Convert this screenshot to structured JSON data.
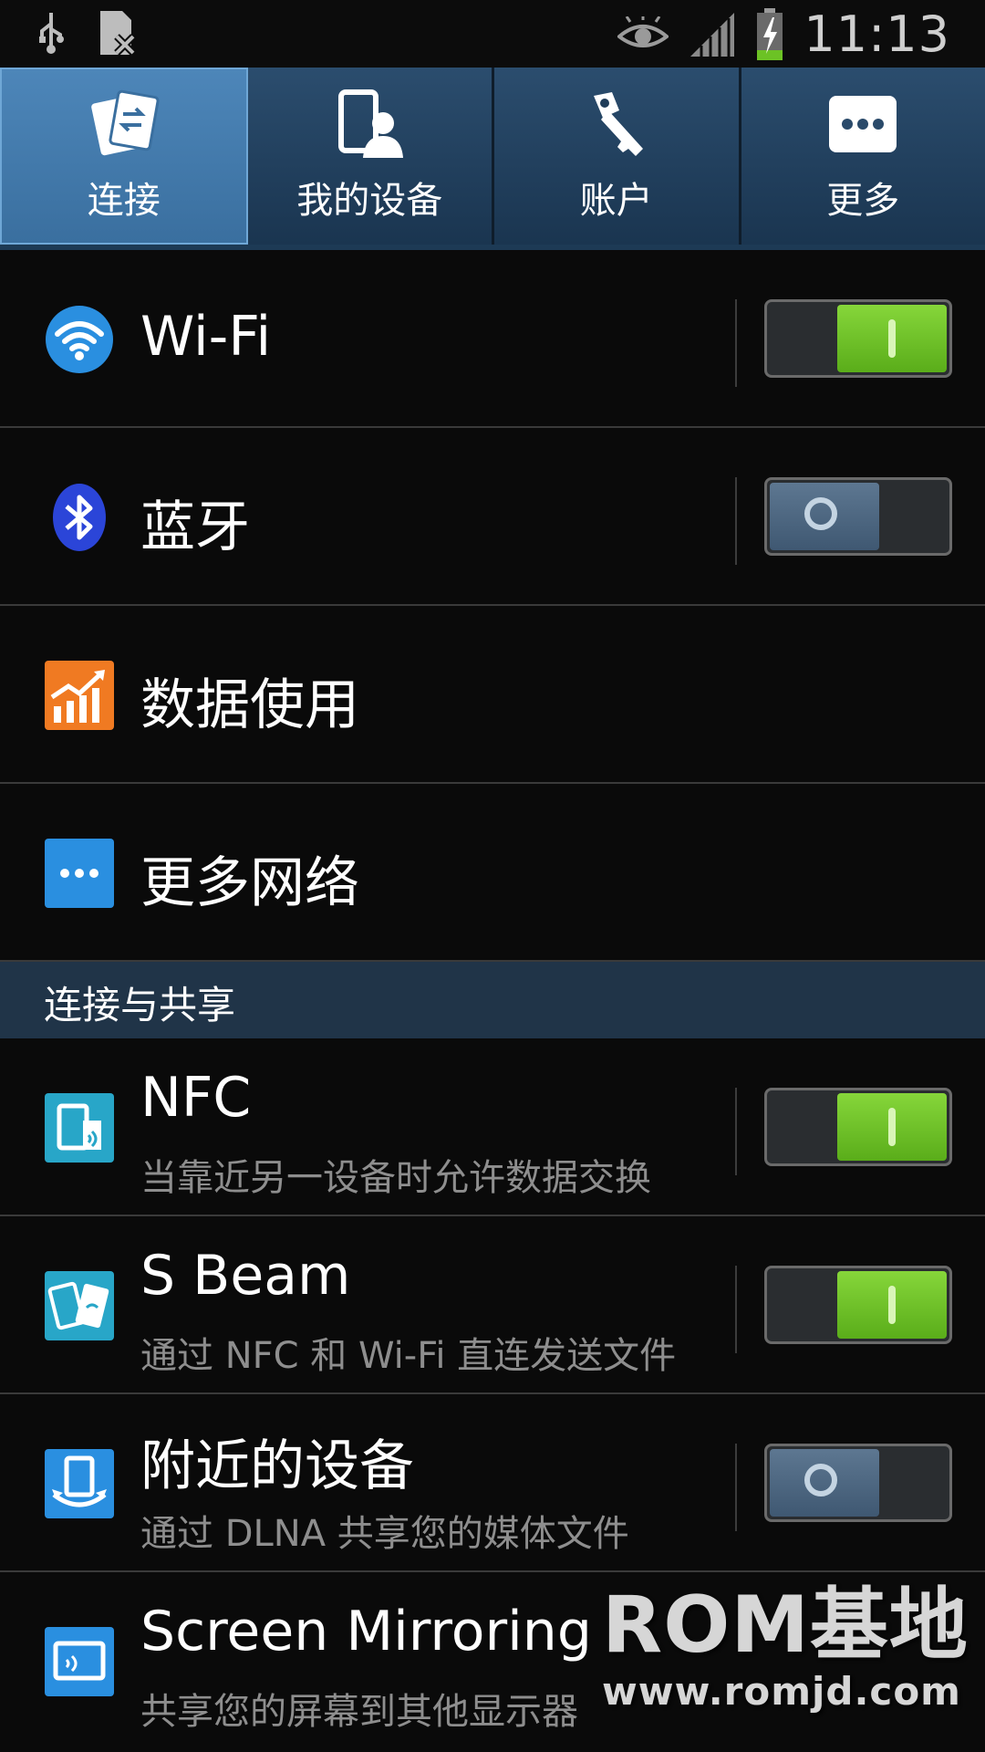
{
  "status_bar": {
    "time": "11:13",
    "left_icons": [
      "usb-icon",
      "no-sim-icon"
    ],
    "right_icons": [
      "eye-icon",
      "signal-icon",
      "battery-charging-icon"
    ]
  },
  "tabs": [
    {
      "label": "连接",
      "icon": "connections-icon",
      "active": true
    },
    {
      "label": "我的设备",
      "icon": "my-device-icon",
      "active": false
    },
    {
      "label": "账户",
      "icon": "accounts-key-icon",
      "active": false
    },
    {
      "label": "更多",
      "icon": "more-dots-icon",
      "active": false
    }
  ],
  "rows": {
    "wifi": {
      "title": "Wi-Fi",
      "toggle": "on"
    },
    "bluetooth": {
      "title": "蓝牙",
      "toggle": "off"
    },
    "data_usage": {
      "title": "数据使用"
    },
    "more_networks": {
      "title": "更多网络"
    }
  },
  "section": {
    "label": "连接与共享"
  },
  "sharing_rows": {
    "nfc": {
      "title": "NFC",
      "subtitle": "当靠近另一设备时允许数据交换",
      "toggle": "on"
    },
    "sbeam": {
      "title": "S Beam",
      "subtitle": "通过 NFC 和 Wi-Fi 直连发送文件",
      "toggle": "on"
    },
    "nearby": {
      "title": "附近的设备",
      "subtitle": "通过 DLNA 共享您的媒体文件",
      "toggle": "off"
    },
    "mirroring": {
      "title": "Screen Mirroring",
      "subtitle": "共享您的屏幕到其他显示器"
    }
  },
  "watermark": {
    "line1": "ROM基地",
    "line2": "www.romjd.com"
  },
  "colors": {
    "toggle_on": "#6cc225",
    "toggle_off": "#4f6983",
    "tab_active": "#4480b4",
    "section_bg": "#203448"
  }
}
